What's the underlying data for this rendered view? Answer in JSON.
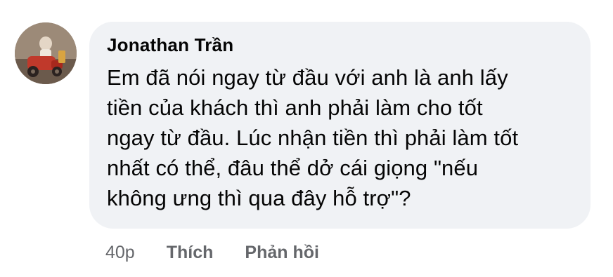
{
  "comment": {
    "author": "Jonathan Trần",
    "lines": [
      "Em đã nói ngay từ đầu với anh là anh lấy",
      "tiền của khách thì anh phải làm cho tốt",
      "ngay từ đầu. Lúc nhận tiền thì phải làm tốt",
      "nhất có thể, đâu thể dở cái giọng \"nếu",
      "không ưng thì qua đây hỗ trợ\"?"
    ],
    "timestamp": "40p",
    "like_label": "Thích",
    "reply_label": "Phản hồi"
  },
  "colors": {
    "bubble_background": "#f0f2f5",
    "text": "#050505",
    "secondary_text": "#65676b"
  }
}
